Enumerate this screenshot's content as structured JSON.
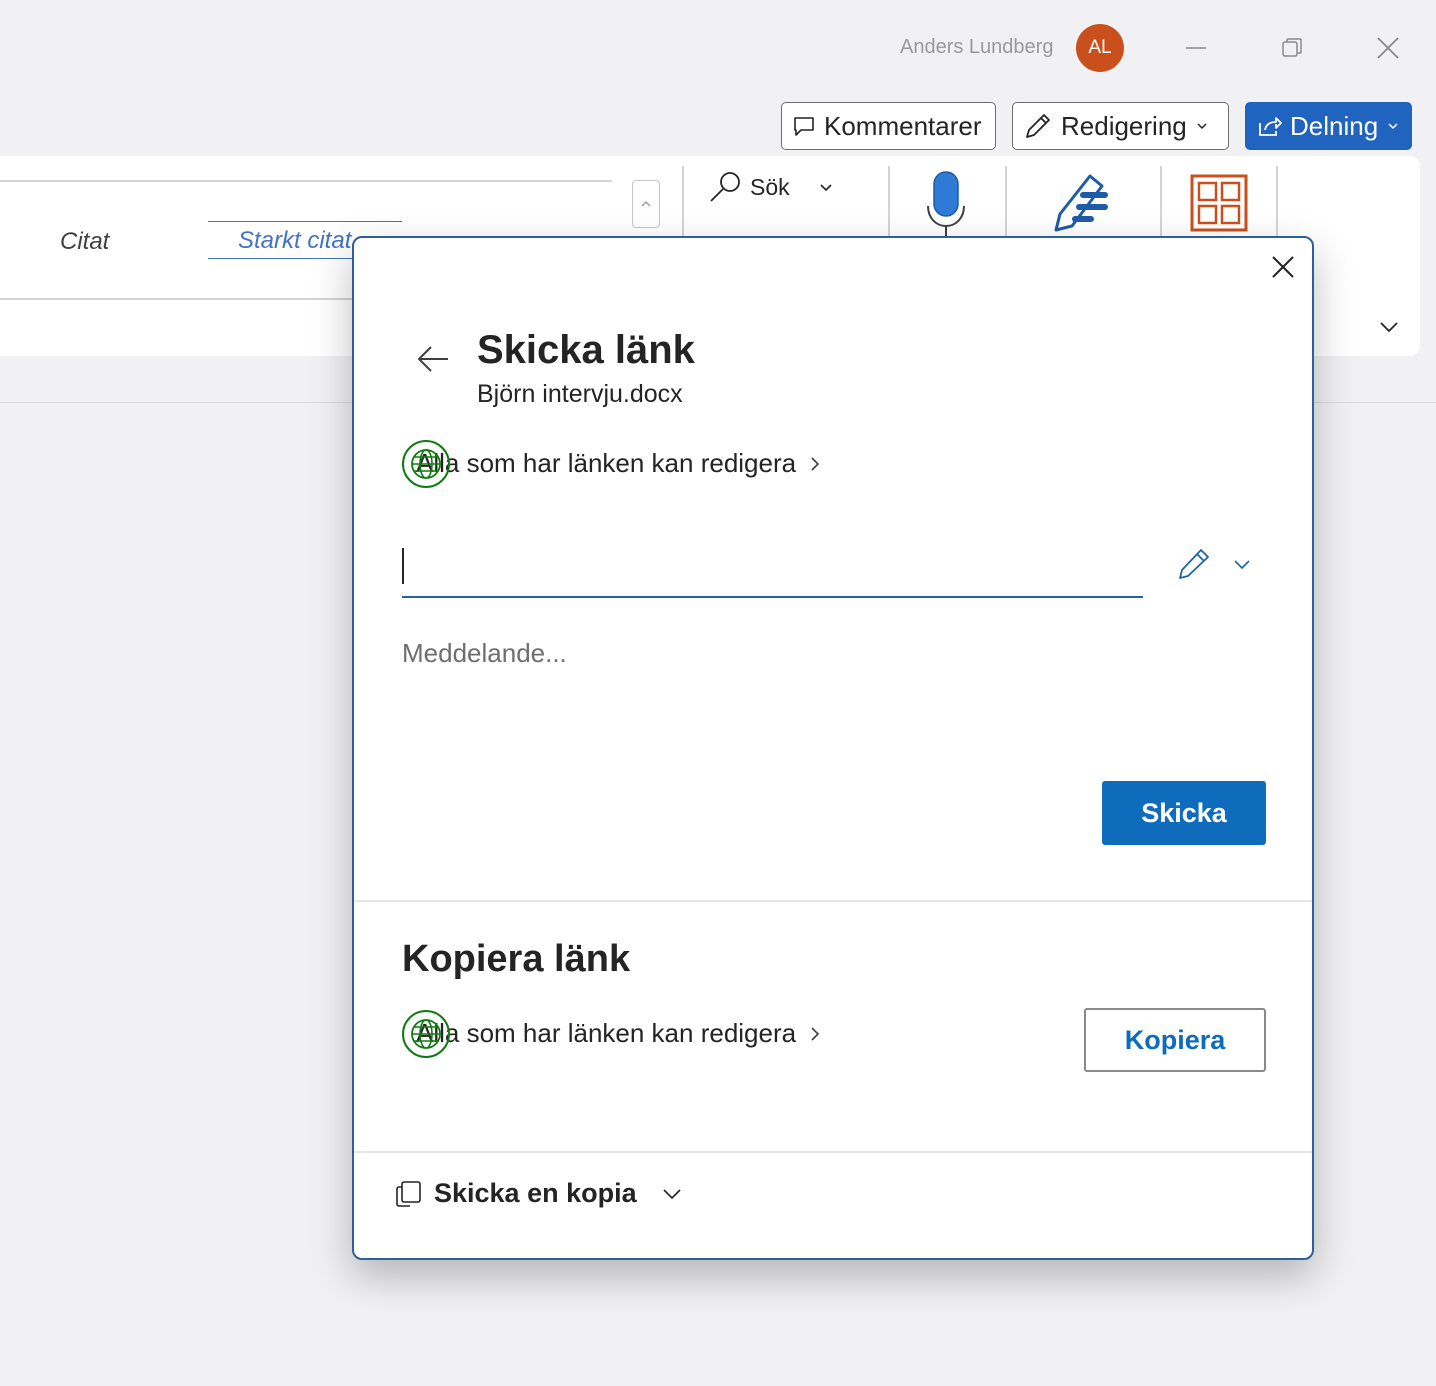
{
  "titlebar": {
    "user_name": "Anders Lundberg",
    "avatar_initials": "AL",
    "avatar_color": "#c9501c"
  },
  "commands": {
    "comments_label": "Kommentarer",
    "editing_label": "Redigering",
    "share_label": "Delning",
    "share_color": "#2064c0"
  },
  "ribbon": {
    "styles": [
      "Citat",
      "Starkt citat"
    ],
    "search_label": "Sök"
  },
  "dialog": {
    "title": "Skicka länk",
    "filename": "Björn intervju.docx",
    "link_permission": "Alla som har länken kan redigera",
    "to_value": "",
    "message_placeholder": "Meddelande...",
    "send_label": "Skicka",
    "send_color": "#0f6cbd",
    "copy_section_title": "Kopiera länk",
    "copy_permission": "Alla som har länken kan redigera",
    "copy_label": "Kopiera",
    "send_copy_label": "Skicka en kopia",
    "globe_color": "#107c10"
  }
}
